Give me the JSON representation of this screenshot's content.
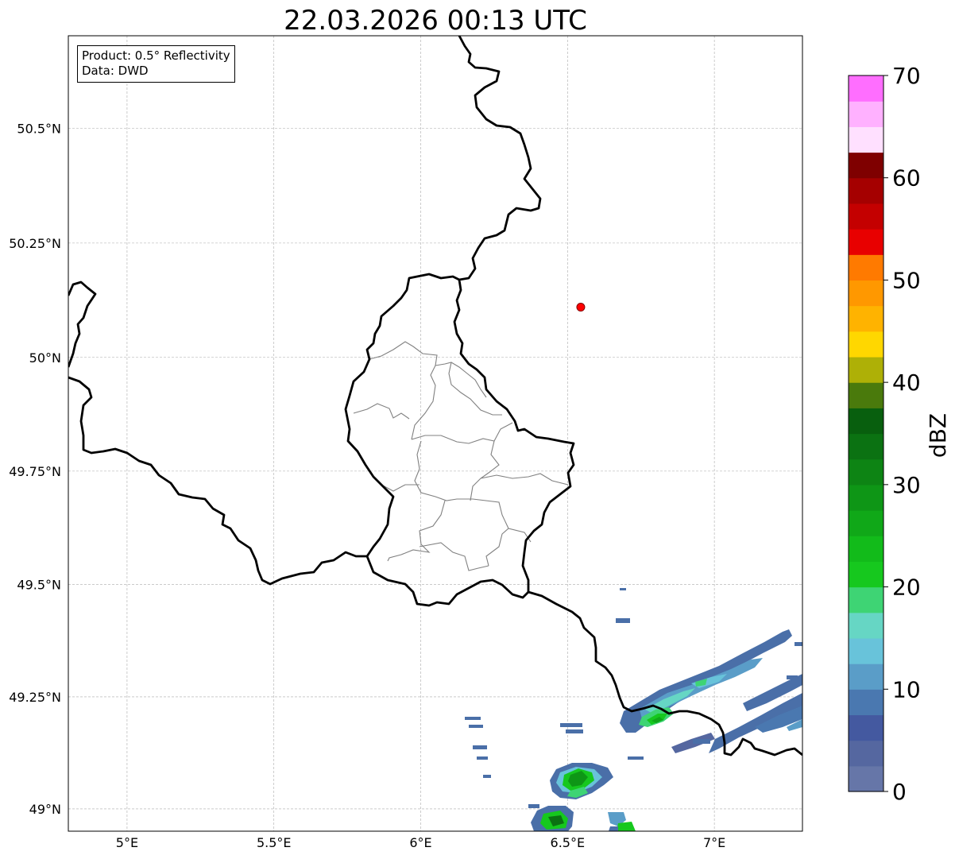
{
  "map": {
    "title": "22.03.2026 00:13 UTC",
    "info_box": {
      "product_line": "Product: 0.5° Reflectivity",
      "data_line": "Data: DWD"
    },
    "lon_ticks": [
      "5°E",
      "5.5°E",
      "6°E",
      "6.5°E",
      "7°E"
    ],
    "lat_ticks": [
      "50.5°N",
      "50.25°N",
      "50°N",
      "49.75°N",
      "49.5°N",
      "49.25°N",
      "49°N"
    ],
    "extent": {
      "lon": [
        4.8,
        7.3
      ],
      "lat": [
        48.95,
        50.7
      ]
    },
    "marker": {
      "lon": 6.545,
      "lat": 50.11,
      "color": "#ff0000"
    },
    "gridlines": true,
    "layers": [
      "country-borders",
      "luxembourg-canton-borders",
      "radar-reflectivity"
    ]
  },
  "colorbar": {
    "label": "dBZ",
    "tick_labels": [
      "0",
      "10",
      "20",
      "30",
      "40",
      "50",
      "60",
      "70"
    ],
    "range": [
      0,
      70
    ],
    "step": 2.5,
    "colors": [
      "#6676a8",
      "#5567a0",
      "#4459a0",
      "#4a78b0",
      "#5a9dc8",
      "#68c3da",
      "#66d6c4",
      "#3ed474",
      "#16c81e",
      "#12bb1a",
      "#10a818",
      "#0e9616",
      "#0d8414",
      "#0b7212",
      "#085f0e",
      "#4a7a0c",
      "#aeb006",
      "#ffd700",
      "#ffb300",
      "#ff9800",
      "#ff7a00",
      "#e80000",
      "#c40000",
      "#a50000",
      "#7f0000",
      "#ffe0ff",
      "#ffb1ff",
      "#ff6eff",
      "#ec38ec"
    ]
  }
}
